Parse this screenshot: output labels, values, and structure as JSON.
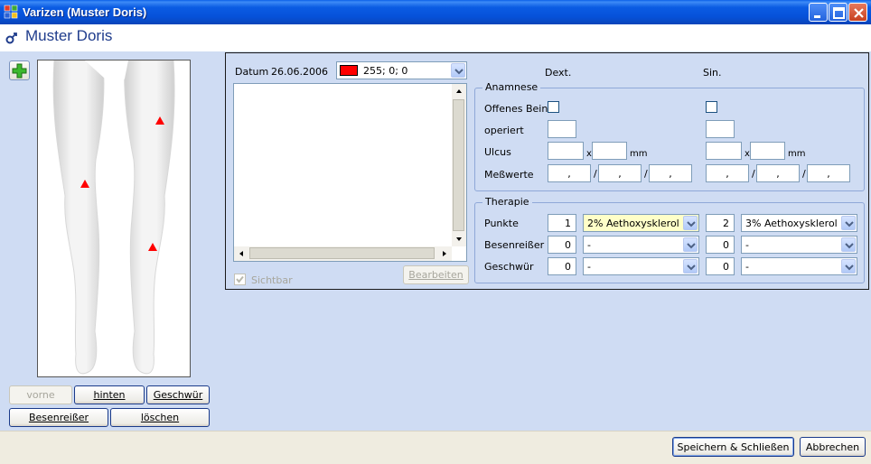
{
  "window": {
    "title": "Varizen (Muster Doris)"
  },
  "header": {
    "patient_name": "Muster Doris"
  },
  "left": {
    "buttons": {
      "vorne": "vorne",
      "hinten": "hinten",
      "geschwuer": "Geschwür",
      "besenreisser": "Besenreißer",
      "loeschen": "löschen"
    }
  },
  "editor": {
    "datum_label": "Datum",
    "datum_value": "26.06.2006",
    "color_value": "255; 0; 0",
    "sichtbar_label": "Sichtbar",
    "bearbeiten_label": "Bearbeiten"
  },
  "columns": {
    "dext": "Dext.",
    "sin": "Sin."
  },
  "anamnese": {
    "title": "Anamnese",
    "offenes_bein": "Offenes Bein",
    "operiert": "operiert",
    "ulcus": "Ulcus",
    "messwerte": "Meßwerte",
    "x": "x",
    "mm": "mm",
    "dot": ",",
    "slash": "/"
  },
  "therapie": {
    "title": "Therapie",
    "rows": [
      {
        "label": "Punkte",
        "dext_count": "1",
        "dext_value": "2% Aethoxysklerol",
        "sin_count": "2",
        "sin_value": "3% Aethoxysklerol"
      },
      {
        "label": "Besenreißer",
        "dext_count": "0",
        "dext_value": "-",
        "sin_count": "0",
        "sin_value": "-"
      },
      {
        "label": "Geschwür",
        "dext_count": "0",
        "dext_value": "-",
        "sin_count": "0",
        "sin_value": "-"
      }
    ]
  },
  "footer": {
    "save_label": "Speichern & Schließen",
    "cancel_label": "Abbrechen"
  },
  "colors": {
    "marker": "#ff0000",
    "titlebar": "#0651d9",
    "content_bg": "#cfdcf3"
  }
}
